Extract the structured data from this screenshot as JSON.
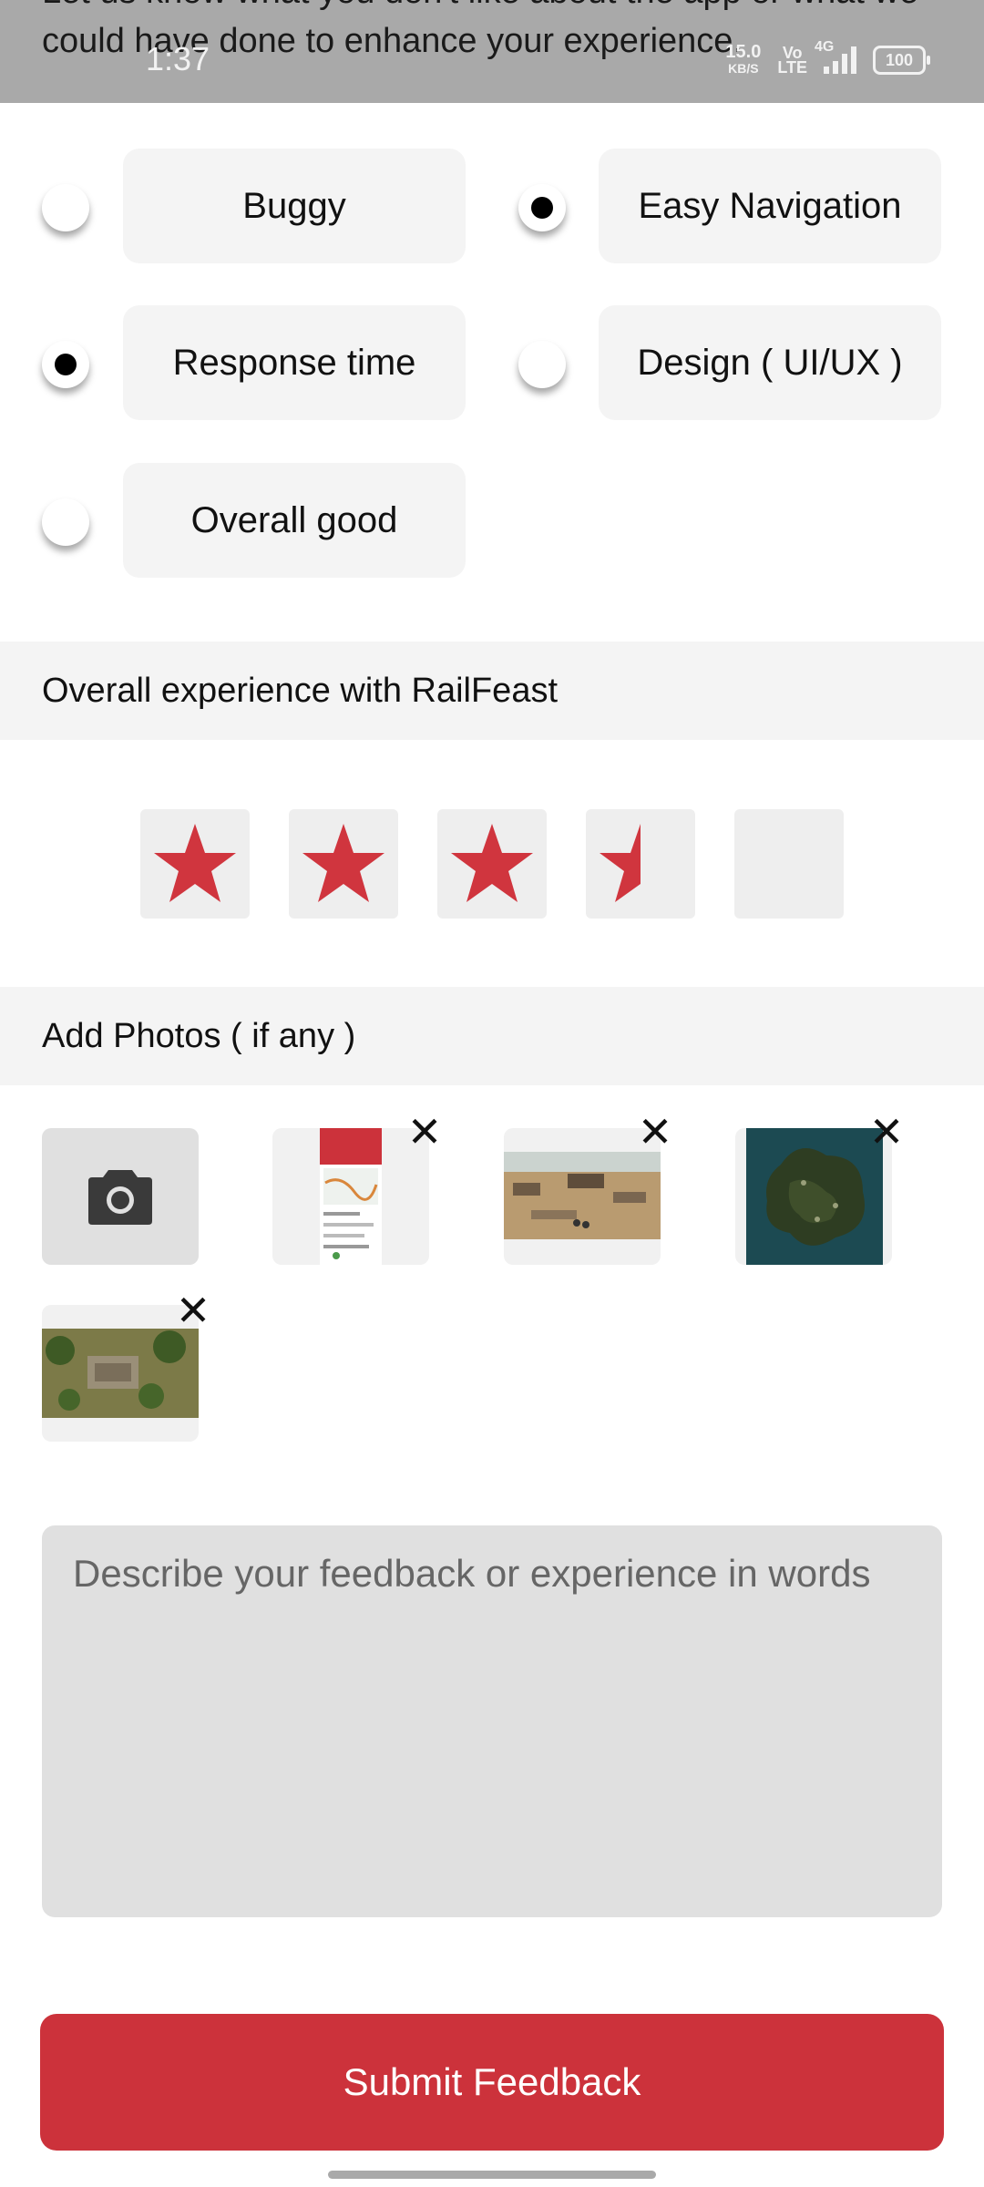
{
  "status_bar": {
    "time": "1:37",
    "net_speed_value": "15.0",
    "net_speed_unit": "KB/S",
    "volte_top": "Vo",
    "volte_bottom": "LTE",
    "network_gen": "4G",
    "battery": "100",
    "underlying_prompt": "Let us know what you don't like about the app or what we could have done to enhance your experience."
  },
  "options": [
    {
      "label": "Buggy",
      "selected": false
    },
    {
      "label": "Easy Navigation",
      "selected": true
    },
    {
      "label": "Response time",
      "selected": true
    },
    {
      "label": "Design ( UI/UX )",
      "selected": false
    },
    {
      "label": "Overall good",
      "selected": false
    }
  ],
  "rating": {
    "heading": "Overall experience with RailFeast",
    "value": 3.5,
    "max": 5,
    "star_color": "#d0353e"
  },
  "photos": {
    "heading": "Add Photos ( if any )",
    "camera_icon": "camera-icon",
    "remove_icon": "✕",
    "count": 4
  },
  "feedback": {
    "placeholder": "Describe your feedback or experience in words",
    "value": ""
  },
  "submit": {
    "label": "Submit Feedback",
    "color": "#cc323b"
  }
}
